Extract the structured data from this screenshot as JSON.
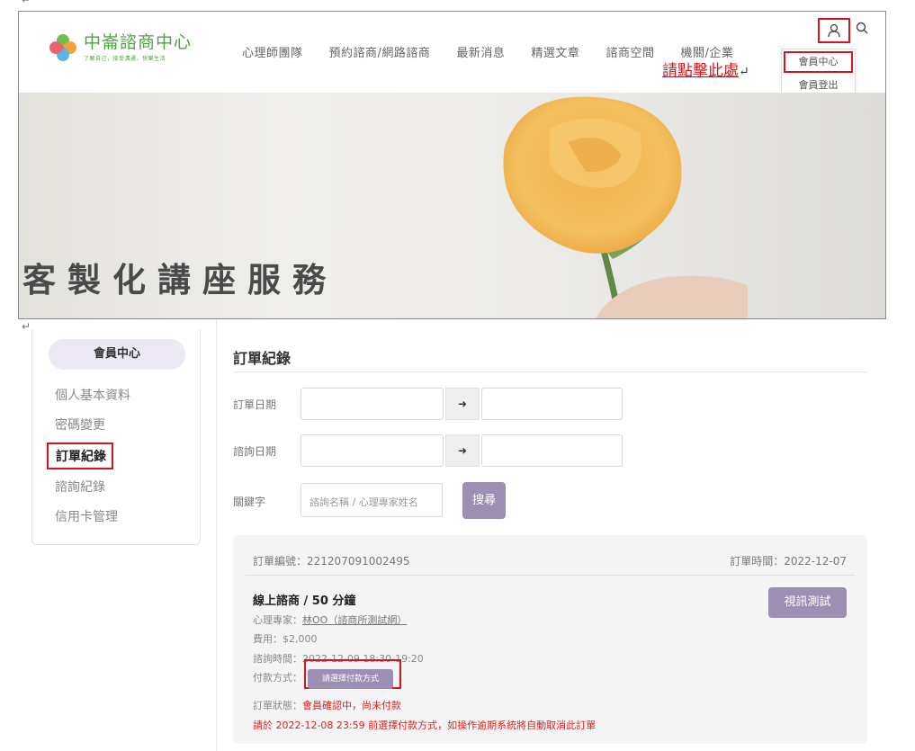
{
  "header": {
    "logo_title": "中崙諮商中心",
    "logo_slogan": "了解自己，接受溝通，快樂生活",
    "nav": [
      "心理師團隊",
      "預約諮商/網路諮商",
      "最新消息",
      "精選文章",
      "諮商空間",
      "機關/企業"
    ],
    "dropdown": [
      "會員中心",
      "會員登出"
    ],
    "annotation": "請點擊此處",
    "return_mark": "↵"
  },
  "banner": {
    "title": "客製化講座服務"
  },
  "sidebar": {
    "heading": "會員中心",
    "items": [
      "個人基本資料",
      "密碼變更",
      "訂單紀錄",
      "諮詢紀錄",
      "信用卡管理"
    ],
    "active_index": 2
  },
  "main": {
    "title": "訂單紀錄",
    "order_date_label": "訂單日期",
    "consult_date_label": "諮詢日期",
    "keyword_label": "關鍵字",
    "keyword_placeholder": "諮詢名稱 / 心理專家姓名",
    "search_button": "搜尋",
    "arrow": "➜"
  },
  "order": {
    "number_label": "訂單編號：",
    "number": "221207091002495",
    "time_label": "訂單時間：",
    "time": "2022-12-07",
    "service": "線上諮商 / 50 分鐘",
    "video_button": "視訊測試",
    "expert_label": "心理專家：",
    "expert": "林OO（諮商所測試網）",
    "fee_label": "費用：",
    "fee": "$2,000",
    "session_label": "諮詢時間：",
    "session": "2022-12-09 18:30-19:20",
    "pay_label": "付款方式：",
    "pay_button": "請選擇付款方式",
    "status_label": "訂單狀態：",
    "status_value": "會員確認中，尚未付款",
    "warning": "請於 2022-12-08 23:59 前選擇付款方式，如操作逾期系統將自動取消此訂單"
  },
  "colors": {
    "accent": "#9c8fb3",
    "highlight": "#d9141b",
    "brand": "#4aa63a",
    "warning": "#e02020"
  }
}
